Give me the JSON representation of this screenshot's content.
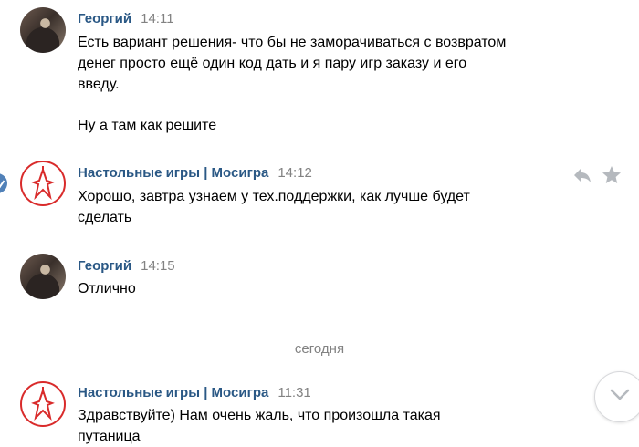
{
  "messages": [
    {
      "author": "Георгий",
      "time": "14:11",
      "avatar": "person-photo",
      "lines": [
        "Есть вариант решения- что бы не заморачиваться с возвратом",
        "денег просто ещё один код дать и я пару игр заказу и его",
        "введу."
      ],
      "extra": "Ну а там как решите"
    },
    {
      "author": "Настольные игры | Мосигра",
      "time": "14:12",
      "avatar": "mosigra-logo",
      "lines": [
        "Хорошо, завтра узнаем у тех.поддержки, как лучше будет",
        "сделать"
      ]
    },
    {
      "author": "Георгий",
      "time": "14:15",
      "avatar": "person-photo",
      "lines": [
        "Отлично"
      ]
    },
    {
      "author": "Настольные игры | Мосигра",
      "time": "11:31",
      "avatar": "mosigra-logo",
      "lines": [
        "Здравствуйте) Нам очень жаль, что произошла такая",
        "путаница"
      ]
    }
  ],
  "date_separator": "сегодня",
  "colors": {
    "author": "#2a5885",
    "time": "#828282",
    "brand_red": "#d92b2b",
    "icon_gray": "#b5b9be",
    "accent": "#5181b8"
  },
  "icons": {
    "reply": "reply-icon",
    "favorite": "star-icon",
    "scroll_down": "chevron-down-icon"
  }
}
